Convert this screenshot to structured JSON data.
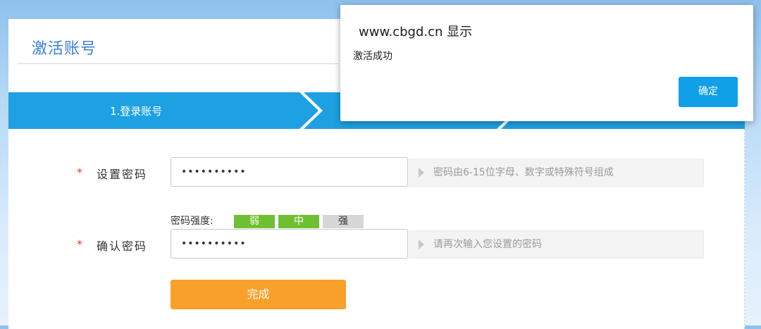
{
  "page": {
    "title": "激活账号"
  },
  "steps": [
    {
      "label": "1.登录账号"
    }
  ],
  "form": {
    "password": {
      "required_mark": "*",
      "label": "设置密码",
      "value": "••••••••••",
      "hint": "密码由6-15位字母、数字或特殊符号组成"
    },
    "strength": {
      "label": "密码强度:",
      "levels": [
        {
          "label": "弱",
          "active": true
        },
        {
          "label": "中",
          "active": true
        },
        {
          "label": "强",
          "active": false
        }
      ]
    },
    "confirm": {
      "required_mark": "*",
      "label": "确认密码",
      "value": "••••••••••",
      "hint": "请再次输入您设置的密码"
    },
    "submit_label": "完成"
  },
  "dialog": {
    "title": "www.cbgd.cn 显示",
    "message": "激活成功",
    "ok_label": "确定"
  },
  "colors": {
    "accent_blue": "#1da1e2",
    "title_blue": "#3a7fd5",
    "submit_orange": "#f9a02b",
    "strength_green": "#6fbf33",
    "required_red": "#e8351d",
    "dialog_button": "#0fa0e8"
  }
}
